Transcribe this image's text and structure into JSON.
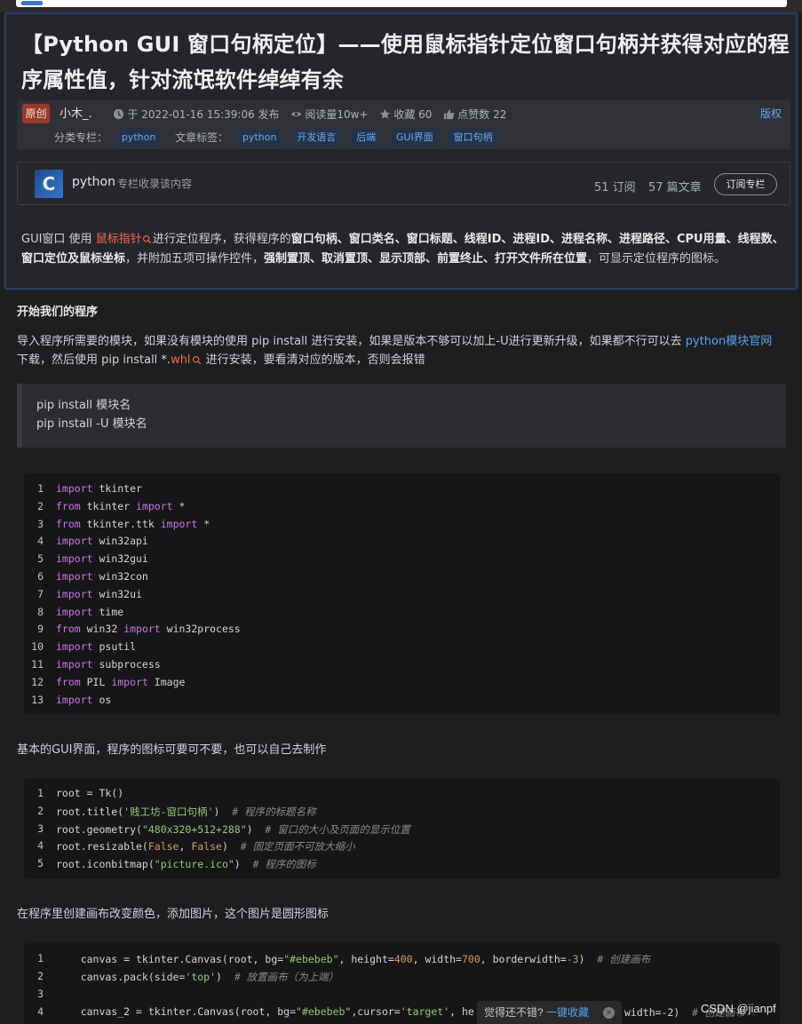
{
  "article": {
    "title": "【Python GUI 窗口句柄定位】——使用鼠标指针定位窗口句柄并获得对应的程序属性值，针对流氓软件绰绰有余",
    "original_badge": "原创",
    "author": "小木_.",
    "date": "于 2022-01-16 15:39:06 发布",
    "reads": "阅读量10w+",
    "favorites": "收藏 60",
    "likes": "点赞数 22",
    "copyright": "版权",
    "category_label": "分类专栏：",
    "category": "python",
    "tags_label": "文章标签：",
    "tags": [
      "python",
      "开发语言",
      "后端",
      "GUI界面",
      "窗口句柄"
    ]
  },
  "column": {
    "logo_letter": "C",
    "name": "python",
    "desc": "专栏收录该内容",
    "subscribers": "51 订阅",
    "articles": "57 篇文章",
    "subscribe_button": "订阅专栏"
  },
  "summary": {
    "t1": "GUI窗口 使用",
    "hl": "鼠标指针",
    "t2": "进行定位程序，获得程序的",
    "b1": "窗口句柄、窗口类名、窗口标题、线程ID、进程ID、进程名称、进程路径、CPU用量、线程数、窗口定位及鼠标坐标",
    "t3": "，并附加五项可操作控件，",
    "b2": "强制置顶、取消置顶、显示顶部、前置终止、打开文件所在位置",
    "t4": "，可显示定位程序的图标。"
  },
  "body": {
    "section_title": "开始我们的程序",
    "p1_a": "导入程序所需要的模块，如果没有模块的使用 pip install 进行安装，如果是版本不够可以加上-U进行更新升级，如果都不行可以去 ",
    "p1_link": "python模块官网",
    "p1_b": " 下载，然后使用 pip install *.",
    "p1_hl": "whl",
    "p1_c": " 进行安装，要看清对应的版本，否则会报错",
    "quote_line1": "pip install 模块名",
    "quote_line2": "pip install -U 模块名",
    "p2": "基本的GUI界面，程序的图标可要可不要，也可以自己去制作",
    "p3": "在程序里创建画布改变颜色，添加图片，这个图片是圆形图标"
  },
  "code1": {
    "line_numbers": [
      "1",
      "2",
      "3",
      "4",
      "5",
      "6",
      "7",
      "8",
      "9",
      "10",
      "11",
      "12",
      "13"
    ],
    "lines": [
      {
        "kw": "import",
        "rest": " tkinter"
      },
      {
        "kw": "from",
        "rest": " tkinter ",
        "kw2": "import",
        "rest2": " *"
      },
      {
        "kw": "from",
        "rest": " tkinter.ttk ",
        "kw2": "import",
        "rest2": " *"
      },
      {
        "kw": "import",
        "rest": " win32api"
      },
      {
        "kw": "import",
        "rest": " win32gui"
      },
      {
        "kw": "import",
        "rest": " win32con"
      },
      {
        "kw": "import",
        "rest": " win32ui"
      },
      {
        "kw": "import",
        "rest": " time"
      },
      {
        "kw": "from",
        "rest": " win32 ",
        "kw2": "import",
        "rest2": " win32process"
      },
      {
        "kw": "import",
        "rest": " psutil"
      },
      {
        "kw": "import",
        "rest": " subprocess"
      },
      {
        "kw": "from",
        "rest": " PIL ",
        "kw2": "import",
        "rest2": " Image"
      },
      {
        "kw": "import",
        "rest": " os"
      }
    ]
  },
  "code2": {
    "line_numbers": [
      "1",
      "2",
      "3",
      "4",
      "5"
    ],
    "l1": "root = Tk()",
    "l2a": "root.title(",
    "l2s": "'贱工坊-窗口句柄'",
    "l2b": ")  ",
    "l2c": "# 程序的标题名称",
    "l3a": "root.geometry(",
    "l3s": "\"480x320+512+288\"",
    "l3b": ")  ",
    "l3c": "# 窗口的大小及页面的显示位置",
    "l4a": "root.resizable(",
    "l4s1": "False",
    "l4m": ", ",
    "l4s2": "False",
    "l4b": ")  ",
    "l4c": "# 固定页面不可放大缩小",
    "l5a": "root.iconbitmap(",
    "l5s": "\"picture.ico\"",
    "l5b": ")  ",
    "l5c": "# 程序的图标"
  },
  "code3": {
    "line_numbers": [
      "1",
      "2",
      "3",
      "4"
    ],
    "l1a": "    canvas = tkinter.Canvas(root, bg=",
    "l1s": "\"#ebebeb\"",
    "l1b": ", height=",
    "l1n1": "400",
    "l1c": ", width=",
    "l1n2": "700",
    "l1d": ", borderwidth=",
    "l1n3": "-3",
    "l1e": ")  ",
    "l1cm": "# 创建画布",
    "l2a": "    canvas.pack(side=",
    "l2s": "'top'",
    "l2b": ")  ",
    "l2cm": "# 放置画布（为上端）",
    "l3": "",
    "l4a": "    canvas_2 = tkinter.Canvas(root, bg=",
    "l4s": "\"#ebebeb\"",
    "l4b": ",cursor=",
    "l4s2": "'target'",
    "l4c": ", he",
    "l4tail": "width=-2)",
    "l4cm": "# 创建画布"
  },
  "toast": {
    "text": "觉得还不错?",
    "link": "一键收藏",
    "close": "×"
  },
  "watermark": "CSDN @jianpf",
  "colors": {
    "background": "#1e1e20",
    "link": "#5aa2ee",
    "highlight": "#f26a5a",
    "keyword": "#c678dd",
    "string": "#98c379"
  }
}
